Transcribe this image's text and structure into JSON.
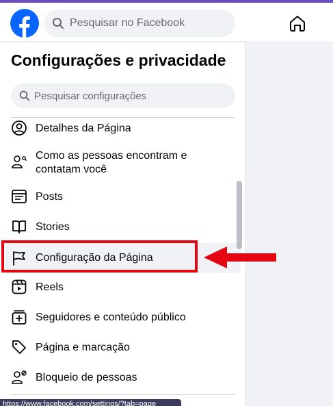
{
  "header": {
    "search_placeholder": "Pesquisar no Facebook"
  },
  "panel": {
    "title": "Configurações e privacidade",
    "search_placeholder": "Pesquisar configurações",
    "items": [
      {
        "label": "Detalhes da Página",
        "icon": "user-circle-icon"
      },
      {
        "label": "Como as pessoas encontram e contatam você",
        "icon": "person-search-icon"
      },
      {
        "label": "Posts",
        "icon": "posts-icon"
      },
      {
        "label": "Stories",
        "icon": "book-open-icon"
      },
      {
        "label": "Configuração da Página",
        "icon": "flag-icon"
      },
      {
        "label": "Reels",
        "icon": "reels-icon"
      },
      {
        "label": "Seguidores e conteúdo público",
        "icon": "public-content-icon"
      },
      {
        "label": "Página e marcação",
        "icon": "tag-icon"
      },
      {
        "label": "Bloqueio de pessoas",
        "icon": "block-people-icon"
      }
    ]
  },
  "status_bar": {
    "url": "https://www.facebook.com/settings/?tab=page"
  },
  "colors": {
    "facebook_blue": "#0866ff",
    "highlight_red": "#e30613",
    "accent_purple": "#6b4fbb"
  }
}
